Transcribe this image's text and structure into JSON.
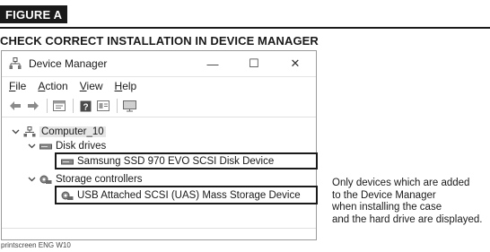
{
  "figure": {
    "label": "FIGURE A",
    "heading": "CHECK CORRECT INSTALLATION IN DEVICE MANAGER"
  },
  "window": {
    "title": "Device Manager",
    "controls": {
      "minimize": "—",
      "maximize": "☐",
      "close": "✕"
    },
    "menu": [
      {
        "first": "F",
        "rest": "ile"
      },
      {
        "first": "A",
        "rest": "ction"
      },
      {
        "first": "V",
        "rest": "iew"
      },
      {
        "first": "H",
        "rest": "elp"
      }
    ]
  },
  "tree": {
    "computer": "Computer_10",
    "disk_drives": "Disk drives",
    "disk_device": "Samsung SSD 970 EVO SCSI Disk Device",
    "storage_controllers": "Storage controllers",
    "storage_device": "USB Attached SCSI (UAS) Mass Storage Device"
  },
  "note": {
    "line1": "Only devices which are added",
    "line2": "to the Device Manager",
    "line3": "when installing the case",
    "line4": "and the hard drive are displayed."
  },
  "credit": "printscreen ENG W10",
  "icons": {
    "app": "device-manager-icon",
    "back": "back-arrow-icon",
    "forward": "forward-arrow-icon",
    "properties": "properties-icon",
    "help": "help-icon",
    "update": "update-driver-icon",
    "monitor": "monitor-icon"
  }
}
